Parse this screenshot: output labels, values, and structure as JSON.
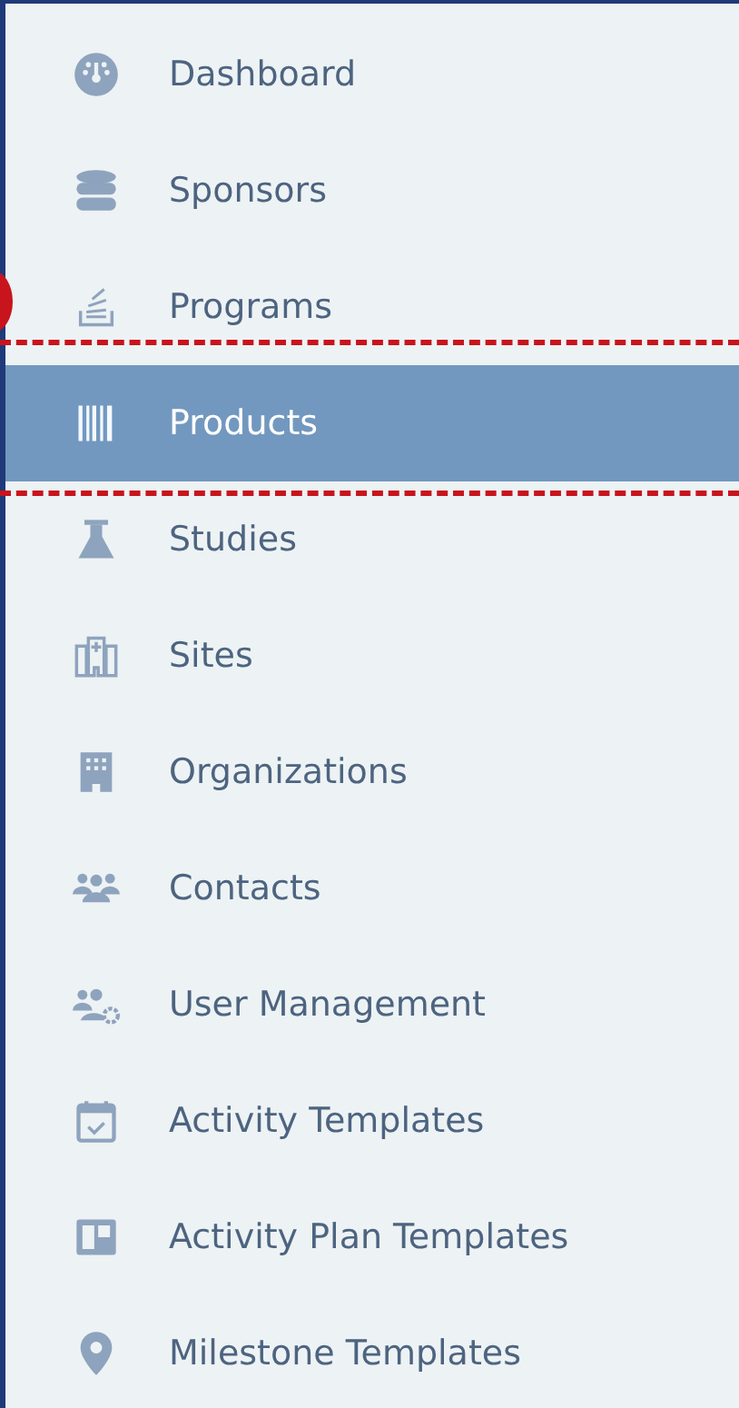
{
  "sidebar": {
    "items": [
      {
        "label": "Dashboard",
        "selected": false
      },
      {
        "label": "Sponsors",
        "selected": false
      },
      {
        "label": "Programs",
        "selected": false
      },
      {
        "label": "Products",
        "selected": true
      },
      {
        "label": "Studies",
        "selected": false
      },
      {
        "label": "Sites",
        "selected": false
      },
      {
        "label": "Organizations",
        "selected": false
      },
      {
        "label": "Contacts",
        "selected": false
      },
      {
        "label": "User Management",
        "selected": false
      },
      {
        "label": "Activity Templates",
        "selected": false
      },
      {
        "label": "Activity Plan Templates",
        "selected": false
      },
      {
        "label": "Milestone Templates",
        "selected": false
      }
    ]
  }
}
